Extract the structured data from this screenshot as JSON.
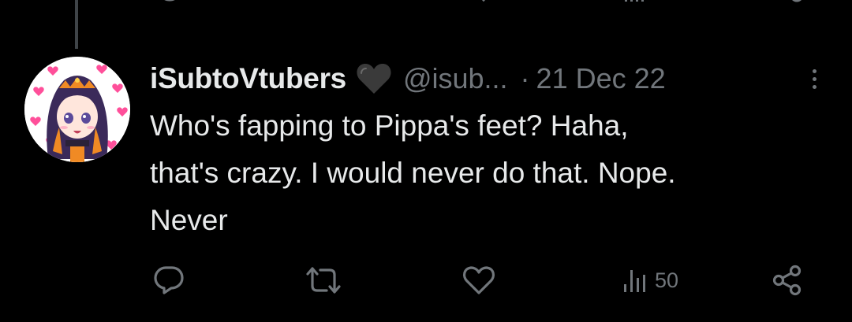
{
  "tweet": {
    "display_name": "iSubtoVtubers",
    "name_emoji": "black-heart-emoji",
    "handle": "@isub...",
    "separator": "·",
    "date": "21 Dec 22",
    "text_lines": [
      "Who's fapping to Pippa's feet? Haha,",
      "that's crazy. I would never do that. Nope.",
      "Never"
    ]
  },
  "actions": {
    "reply_icon": "reply-icon",
    "retweet_icon": "retweet-icon",
    "like_icon": "heart-icon",
    "views_icon": "views-icon",
    "views_count": "50",
    "share_icon": "share-icon"
  },
  "colors": {
    "background": "#000000",
    "primary_text": "#e7e9ea",
    "secondary_text": "#71767b",
    "thread_line": "#3f4448"
  }
}
